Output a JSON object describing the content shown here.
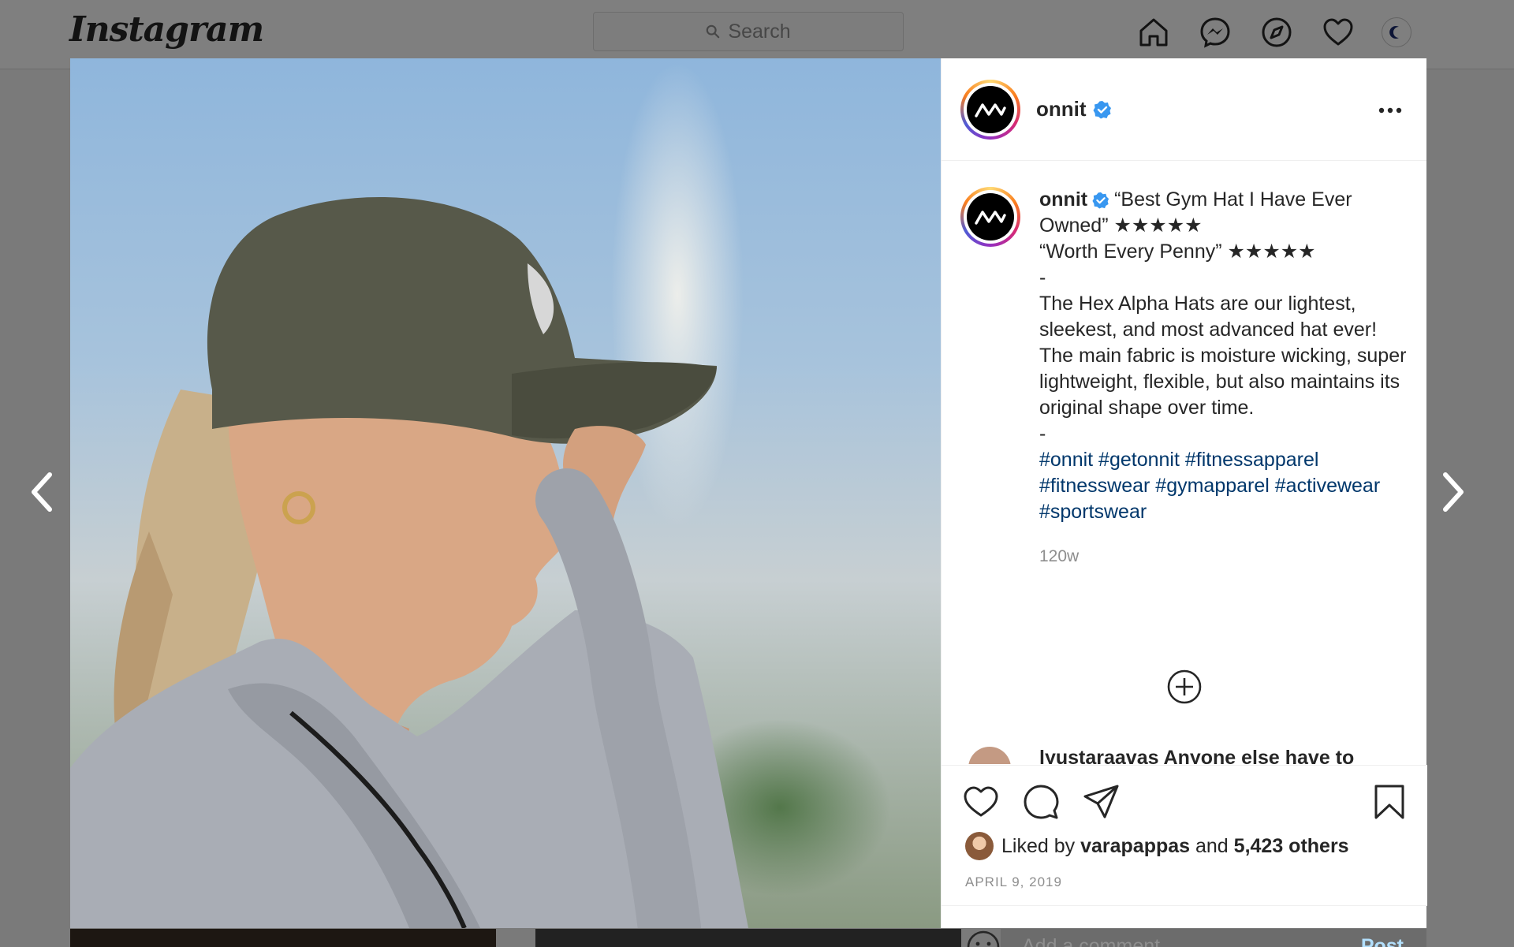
{
  "app": {
    "logo_text": "Instagram",
    "search_placeholder": "Search"
  },
  "post": {
    "username": "onnit",
    "caption_lines": [
      "“Best Gym Hat I Have Ever Owned” ★★★★★",
      "“Worth Every Penny” ★★★★★",
      "-",
      "The Hex Alpha Hats are our lightest, sleekest, and most advanced hat ever! The main fabric is moisture wicking, super lightweight, flexible, but also maintains its original shape over time.",
      "-"
    ],
    "hashtags": "#onnit #getonnit #fitnessapparel #fitnesswear #gymapparel #activewear #sportswear",
    "time_ago": "120w",
    "partial_comment": "lyustaraavas Anyone else have to",
    "liked_by_prefix": "Liked by",
    "liked_by_user": "varapappas",
    "liked_by_joiner": "and",
    "liked_by_others": "5,423 others",
    "date": "APRIL 9, 2019"
  },
  "comment_box": {
    "placeholder": "Add a comment...",
    "post_label": "Post"
  },
  "colors": {
    "verified_blue": "#3897f0",
    "hashtag_blue": "#00376b",
    "post_button_disabled": "#b2dffc"
  },
  "icons": [
    "home-icon",
    "messenger-icon",
    "explore-icon",
    "activity-heart-icon",
    "profile-avatar",
    "more-options-icon",
    "like-icon",
    "comment-icon",
    "share-icon",
    "save-icon",
    "emoji-icon",
    "load-more-comments-icon",
    "prev-arrow-icon",
    "next-arrow-icon"
  ]
}
